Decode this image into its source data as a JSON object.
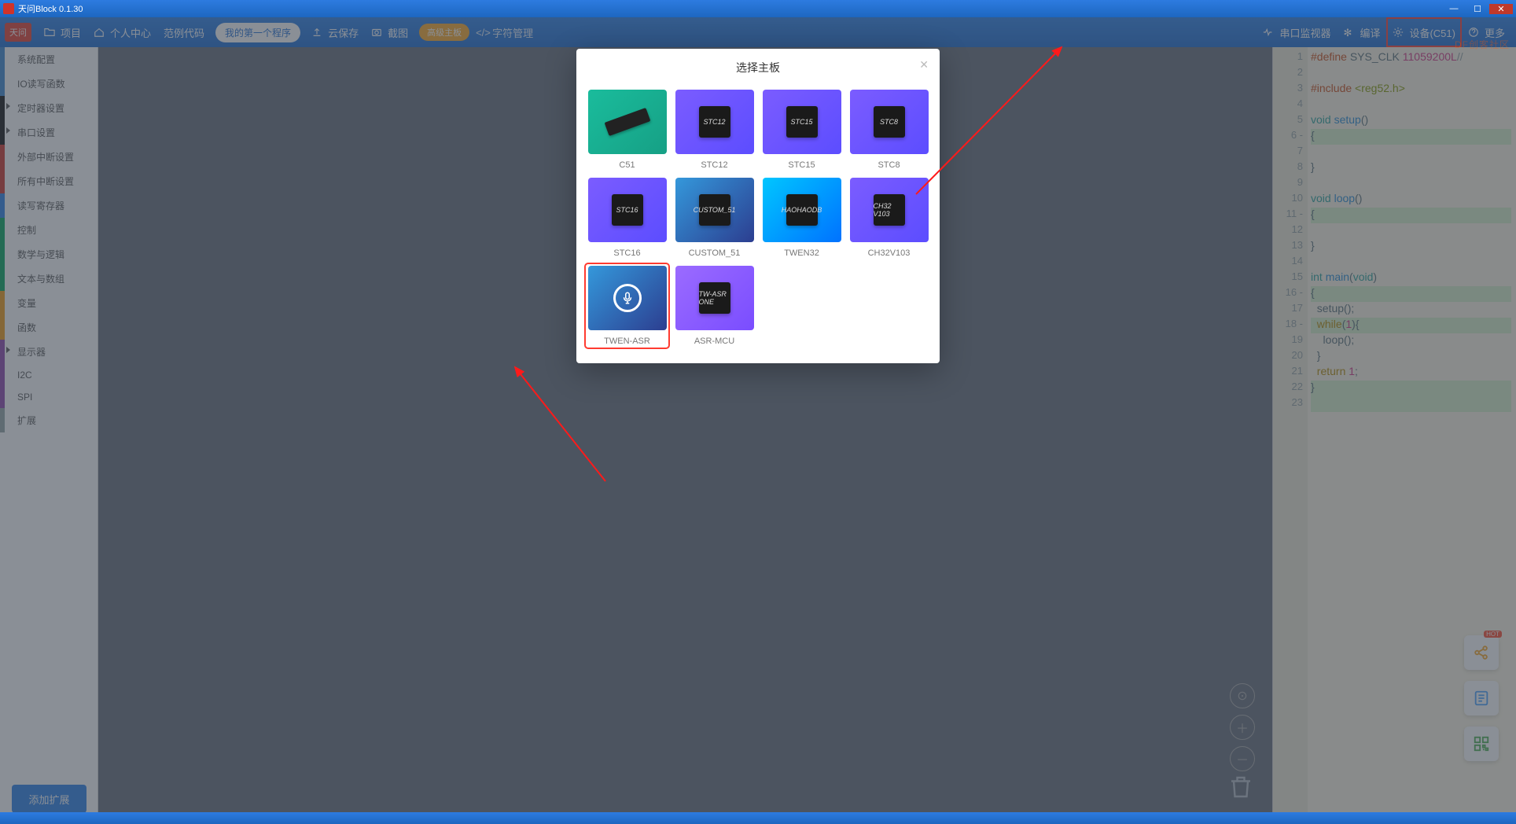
{
  "window": {
    "title": "天问Block 0.1.30"
  },
  "toolbar": {
    "logo_text": "天问",
    "items": {
      "project": "项目",
      "personal": "个人中心",
      "examples": "范例代码",
      "current_file": "我的第一个程序",
      "cloud_save": "云保存",
      "screenshot": "截图",
      "serial": "串口监视器",
      "compile": "编译",
      "device": "设备(C51)",
      "more": "更多"
    },
    "orange_pill": "高级主板",
    "char_btn": "字符管理"
  },
  "sidebar": {
    "items": [
      {
        "label": "系统配置",
        "color": "#3a87d1",
        "tri": false
      },
      {
        "label": "IO读写函数",
        "color": "#3a87d1",
        "tri": false
      },
      {
        "label": "定时器设置",
        "color": "#111111",
        "tri": true
      },
      {
        "label": "串口设置",
        "color": "#111111",
        "tri": true
      },
      {
        "label": "外部中断设置",
        "color": "#d0332a",
        "tri": false
      },
      {
        "label": "所有中断设置",
        "color": "#d0332a",
        "tri": false
      },
      {
        "label": "读写寄存器",
        "color": "#2a80e8",
        "tri": false
      },
      {
        "label": "控制",
        "color": "#00a65a",
        "tri": false
      },
      {
        "label": "数学与逻辑",
        "color": "#00a65a",
        "tri": false
      },
      {
        "label": "文本与数组",
        "color": "#00a65a",
        "tri": false
      },
      {
        "label": "变量",
        "color": "#f39c12",
        "tri": false
      },
      {
        "label": "函数",
        "color": "#f39c12",
        "tri": false
      },
      {
        "label": "显示器",
        "color": "#8e44ad",
        "tri": true
      },
      {
        "label": "I2C",
        "color": "#8e44ad",
        "tri": false
      },
      {
        "label": "SPI",
        "color": "#8e44ad",
        "tri": false
      },
      {
        "label": "扩展",
        "color": "#95a5a6",
        "tri": false
      }
    ],
    "add_ext": "添加扩展"
  },
  "modal": {
    "title": "选择主板",
    "close": "✕",
    "boards": [
      {
        "id": "c51",
        "label": "C51",
        "style": "teal",
        "kind": "dil"
      },
      {
        "id": "stc12",
        "label": "STC12",
        "style": "violet",
        "kind": "chip",
        "chip": "STC12"
      },
      {
        "id": "stc15",
        "label": "STC15",
        "style": "violet",
        "kind": "chip",
        "chip": "STC15"
      },
      {
        "id": "stc8",
        "label": "STC8",
        "style": "violet",
        "kind": "chip",
        "chip": "STC8"
      },
      {
        "id": "stc16",
        "label": "STC16",
        "style": "violet",
        "kind": "chip",
        "chip": "STC16"
      },
      {
        "id": "custom51",
        "label": "CUSTOM_51",
        "style": "blue",
        "kind": "chip",
        "chip": "CUSTOM_51"
      },
      {
        "id": "twen32",
        "label": "TWEN32",
        "style": "cyan",
        "kind": "chip",
        "chip": "HAOHAODB"
      },
      {
        "id": "ch32",
        "label": "CH32V103",
        "style": "violet",
        "kind": "chip",
        "chip": "CH32\\nV103"
      },
      {
        "id": "twenasr",
        "label": "TWEN-ASR",
        "style": "blue",
        "kind": "mic",
        "selected": true
      },
      {
        "id": "asrmcu",
        "label": "ASR-MCU",
        "style": "lav",
        "kind": "chip",
        "chip": "TW-ASR\\nONE"
      }
    ]
  },
  "code": {
    "lines": [
      {
        "n": 1,
        "html": "<span class='pp'>#define</span> SYS_CLK <span class='num'>11059200L</span><span class='cm'>//</span>"
      },
      {
        "n": 2,
        "html": ""
      },
      {
        "n": 3,
        "html": "<span class='pp'>#include</span> <span class='str'>&lt;reg52.h&gt;</span>"
      },
      {
        "n": 4,
        "html": ""
      },
      {
        "n": 5,
        "html": "<span class='ty'>void</span> <span class='fn'>setup</span>()"
      },
      {
        "n": 6,
        "html": "{",
        "hl": true,
        "dash": true
      },
      {
        "n": 7,
        "html": ""
      },
      {
        "n": 8,
        "html": "}"
      },
      {
        "n": 9,
        "html": ""
      },
      {
        "n": 10,
        "html": "<span class='ty'>void</span> <span class='fn'>loop</span>()"
      },
      {
        "n": 11,
        "html": "{",
        "hl": true,
        "dash": true
      },
      {
        "n": 12,
        "html": ""
      },
      {
        "n": 13,
        "html": "}"
      },
      {
        "n": 14,
        "html": ""
      },
      {
        "n": 15,
        "html": "<span class='ty'>int</span> <span class='fn'>main</span>(<span class='ty'>void</span>)"
      },
      {
        "n": 16,
        "html": "{",
        "hl": true,
        "dash": true
      },
      {
        "n": 17,
        "html": "  setup();"
      },
      {
        "n": 18,
        "html": "  <span class='kw'>while</span>(<span class='num'>1</span>){",
        "hl": true,
        "dash": true
      },
      {
        "n": 19,
        "html": "    loop();"
      },
      {
        "n": 20,
        "html": "  }"
      },
      {
        "n": 21,
        "html": "  <span class='kw'>return</span> <span class='num'>1</span>;"
      },
      {
        "n": 22,
        "html": "}",
        "hl": true
      },
      {
        "n": 23,
        "html": "",
        "hl": true
      }
    ]
  },
  "watermark": "DF创客社区"
}
